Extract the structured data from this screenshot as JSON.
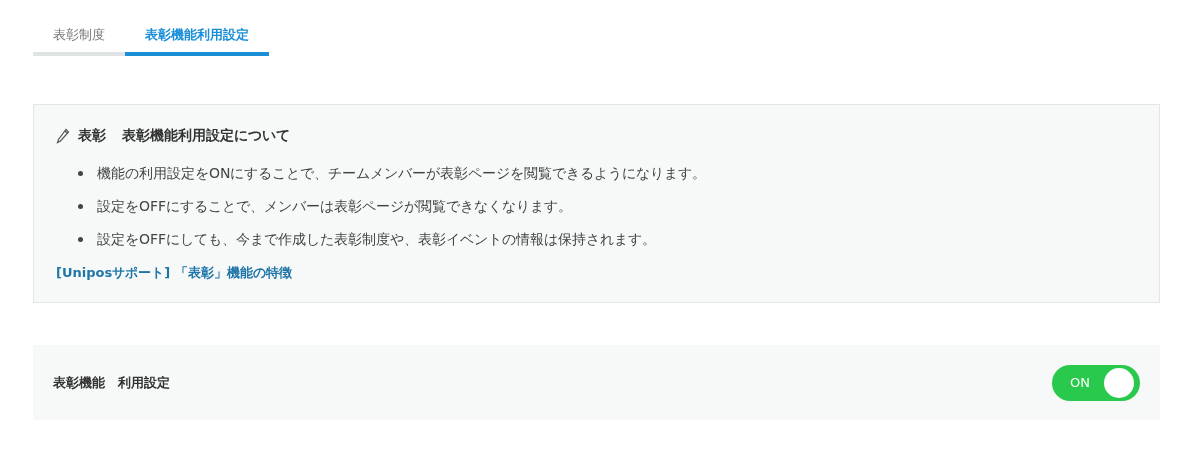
{
  "tabs": [
    {
      "label": "表彰制度",
      "selected": false
    },
    {
      "label": "表彰機能利用設定",
      "selected": true
    }
  ],
  "info": {
    "category": "表彰",
    "title": "表彰機能利用設定について",
    "bullets": [
      "機能の利用設定をONにすることで、チームメンバーが表彰ページを閲覧できるようになります。",
      "設定をOFFにすることで、メンバーは表彰ページが閲覧できなくなります。",
      "設定をOFFにしても、今まで作成した表彰制度や、表彰イベントの情報は保持されます。"
    ],
    "link": "[Uniposサポート] 「表彰」機能の特徴"
  },
  "setting": {
    "label": "表彰機能　利用設定",
    "toggle": {
      "on": true,
      "text": "ON"
    }
  }
}
